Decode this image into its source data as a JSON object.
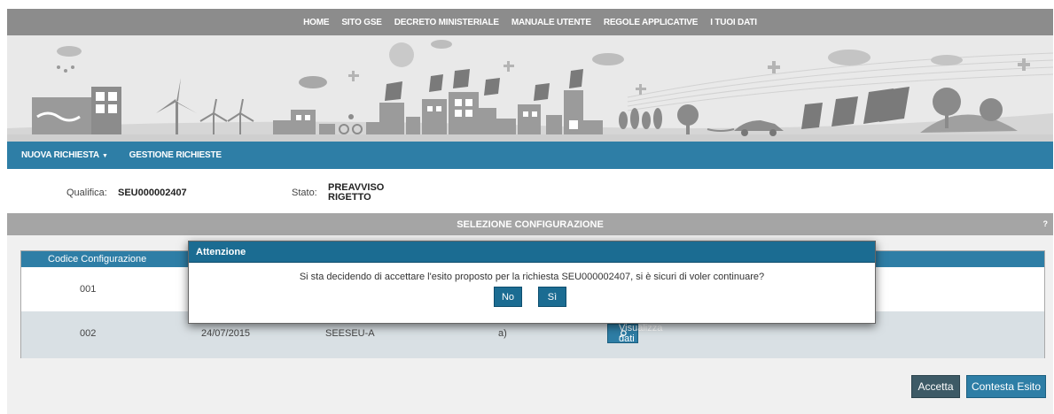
{
  "topnav": {
    "items": [
      "HOME",
      "SITO GSE",
      "DECRETO MINISTERIALE",
      "MANUALE UTENTE",
      "REGOLE APPLICATIVE",
      "I TUOI DATI"
    ]
  },
  "menu": {
    "nuova_richiesta": "NUOVA RICHIESTA",
    "caret": "▼",
    "gestione_richieste": "GESTIONE RICHIESTE"
  },
  "info": {
    "qualifica_label": "Qualifica:",
    "qualifica_value": "SEU000002407",
    "stato_label": "Stato:",
    "stato_value_line1": "PREAVVISO",
    "stato_value_line2": "RIGETTO"
  },
  "section": {
    "title": "SELEZIONE CONFIGURAZIONE",
    "help": "?"
  },
  "table": {
    "header": "Codice Configurazione",
    "rows": [
      {
        "codice": "001"
      },
      {
        "codice": "002",
        "data": "24/07/2015",
        "tipo": "SEESEU-A",
        "lettera": "a)",
        "button": "Visualizza dati"
      }
    ]
  },
  "actions": {
    "accetta": "Accetta",
    "contesta": "Contesta Esito"
  },
  "modal": {
    "title": "Attenzione",
    "message": "Si sta decidendo di accettare l'esito proposto per la richiesta SEU000002407, si è sicuri di voler continuare?",
    "no": "No",
    "si": "Sì"
  },
  "colors": {
    "nav_gray": "#8c8c8c",
    "menu_blue": "#2e7ea6",
    "modal_blue": "#1b6c92",
    "section_gray": "#a5a5a5"
  }
}
